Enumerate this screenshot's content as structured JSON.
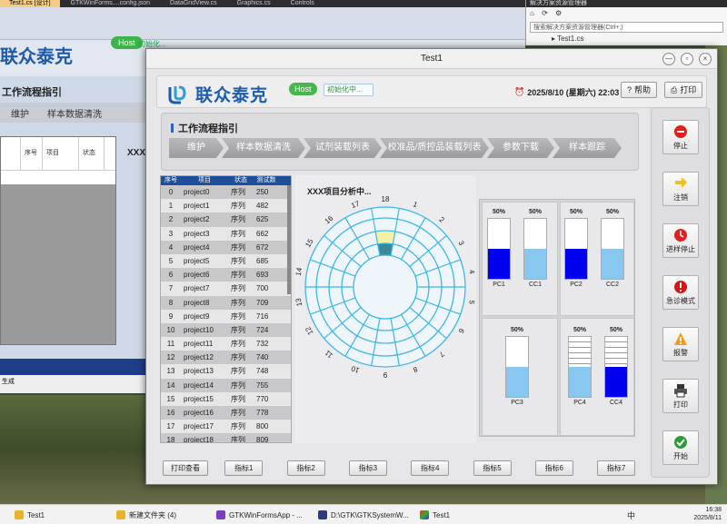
{
  "background": {
    "tabs": [
      "Test1.cs [设计]",
      "GTKWinForms....config.json",
      "DataGridView.cs",
      "Graphics.cs",
      "Controls"
    ],
    "logo_text": "联众泰克",
    "host_label": "Host",
    "host_status": "初始化...",
    "workflow_title": "工作流程指引",
    "tabs_menu": [
      "维护",
      "样本数据清洗"
    ],
    "grid_headers": [
      "序号",
      "项目",
      "状态"
    ],
    "analysis_title": "XXX",
    "solution_explorer": {
      "title": "解决方案资源管理器",
      "search_placeholder": "搜索解决方案资源管理器(Ctrl+;)",
      "tree_item": "Test1.cs"
    },
    "bottom_text": "生成"
  },
  "window": {
    "title": "Test1",
    "controls": [
      "—",
      "▫",
      "×"
    ]
  },
  "header": {
    "logo_text": "联众泰克",
    "host_label": "Host",
    "host_status": "初始化中...",
    "datetime": "2025/8/10 (星期六) 22:03",
    "help_label": "帮助",
    "print_label": "打印"
  },
  "workflow": {
    "title": "工作流程指引",
    "steps": [
      "维护",
      "样本数据清洗",
      "试剂装载列表",
      "校准品/质控品装载列表",
      "参数下载",
      "样本跟踪"
    ]
  },
  "table": {
    "headers": [
      "序号",
      "项目",
      "状态",
      "测试数"
    ],
    "rows": [
      [
        "0",
        "project0",
        "序列",
        "250"
      ],
      [
        "1",
        "project1",
        "序列",
        "482"
      ],
      [
        "2",
        "project2",
        "序列",
        "625"
      ],
      [
        "3",
        "project3",
        "序列",
        "662"
      ],
      [
        "4",
        "project4",
        "序列",
        "672"
      ],
      [
        "5",
        "project5",
        "序列",
        "685"
      ],
      [
        "6",
        "project6",
        "序列",
        "693"
      ],
      [
        "7",
        "project7",
        "序列",
        "700"
      ],
      [
        "8",
        "project8",
        "序列",
        "709"
      ],
      [
        "9",
        "project9",
        "序列",
        "716"
      ],
      [
        "10",
        "project10",
        "序列",
        "724"
      ],
      [
        "11",
        "project11",
        "序列",
        "732"
      ],
      [
        "12",
        "project12",
        "序列",
        "740"
      ],
      [
        "13",
        "project13",
        "序列",
        "748"
      ],
      [
        "14",
        "project14",
        "序列",
        "755"
      ],
      [
        "15",
        "project15",
        "序列",
        "770"
      ],
      [
        "16",
        "project16",
        "序列",
        "778"
      ],
      [
        "17",
        "project17",
        "序列",
        "800"
      ],
      [
        "18",
        "project18",
        "序列",
        "809"
      ]
    ]
  },
  "analysis": {
    "title": "XXX项目分析中...",
    "wheel_labels": [
      "18",
      "1",
      "2",
      "3",
      "4",
      "5",
      "6",
      "7",
      "8",
      "9",
      "10",
      "11",
      "12",
      "13",
      "14",
      "15",
      "16",
      "17"
    ],
    "highlighted_segments": [
      0,
      1
    ],
    "ring_color": "#3fb6e6"
  },
  "gauges": {
    "items": [
      {
        "name": "PC1",
        "pct": "50%",
        "level": 0.5,
        "color": "#0000ee"
      },
      {
        "name": "CC1",
        "pct": "50%",
        "level": 0.5,
        "color": "#88c8f0"
      },
      {
        "name": "PC2",
        "pct": "50%",
        "level": 0.5,
        "color": "#0000ee"
      },
      {
        "name": "CC2",
        "pct": "50%",
        "level": 0.5,
        "color": "#88c8f0"
      },
      {
        "name": "PC3",
        "pct": "50%",
        "level": 0.5,
        "color": "#88c8f0"
      },
      {
        "name": "PC4",
        "pct": "50%",
        "level": 0.5,
        "color": "#88c8f0"
      },
      {
        "name": "CC4",
        "pct": "50%",
        "level": 0.5,
        "color": "#0000ee"
      }
    ]
  },
  "side_buttons": [
    {
      "label": "停止",
      "icon": "stop-icon"
    },
    {
      "label": "注销",
      "icon": "logout-icon"
    },
    {
      "label": "进样停止",
      "icon": "clock-stop-icon"
    },
    {
      "label": "急诊模式",
      "icon": "emergency-icon"
    },
    {
      "label": "报警",
      "icon": "warning-icon"
    },
    {
      "label": "打印",
      "icon": "printer-icon"
    },
    {
      "label": "开始",
      "icon": "start-icon"
    }
  ],
  "bottom_buttons": [
    "打印查看",
    "指标1",
    "指标2",
    "指标3",
    "指标4",
    "指标5",
    "指标6",
    "指标7"
  ],
  "taskbar": {
    "items": [
      "Test1",
      "新建文件夹 (4)",
      "GTKWinFormsApp - ...",
      "D:\\GTK\\GTKSystemW...",
      "Test1"
    ],
    "time": "16:38",
    "date": "2025/8/11",
    "lang": "中"
  }
}
